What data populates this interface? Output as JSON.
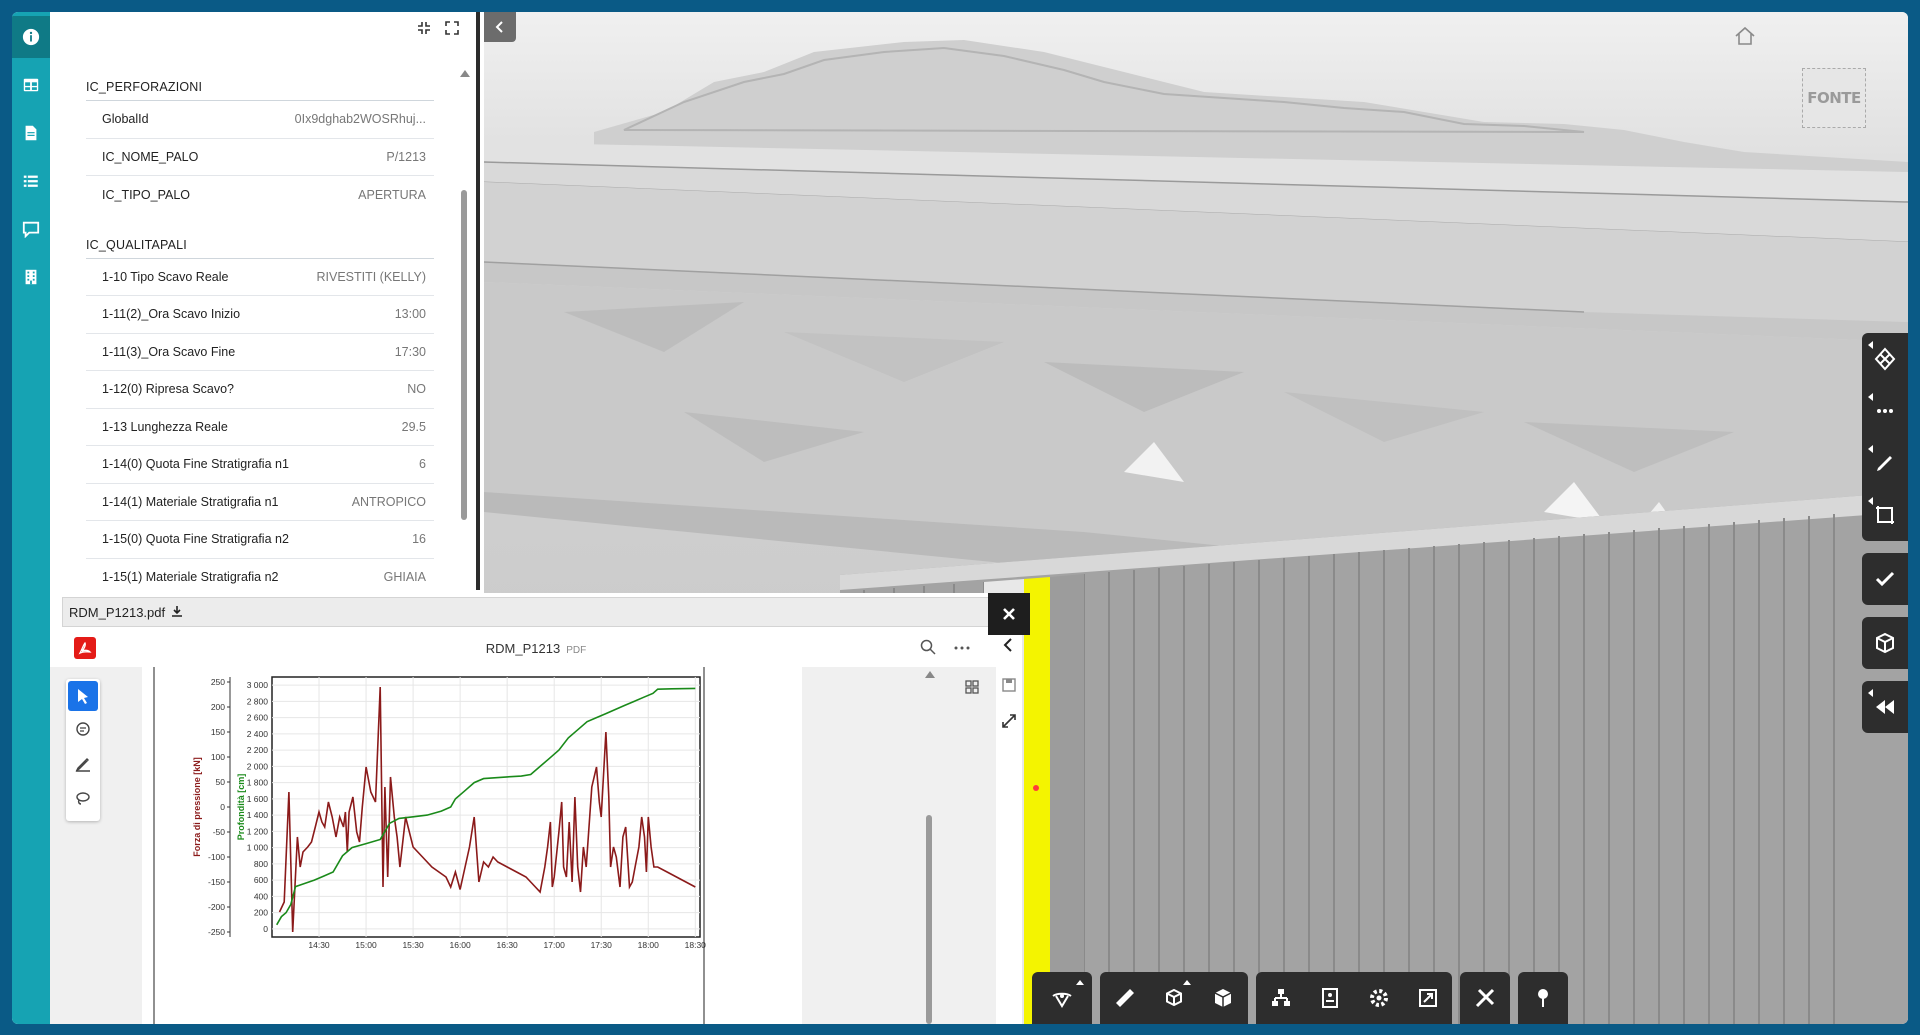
{
  "rail": {
    "items": [
      {
        "name": "info-icon",
        "active": true
      },
      {
        "name": "table-icon"
      },
      {
        "name": "document-icon"
      },
      {
        "name": "list-icon"
      },
      {
        "name": "comment-icon"
      },
      {
        "name": "building-icon"
      }
    ]
  },
  "props": {
    "groups": [
      {
        "title": "IC_PERFORAZIONI",
        "rows": [
          {
            "key": "GlobalId",
            "value": "0Ix9dghab2WOSRhuj..."
          },
          {
            "key": "IC_NOME_PALO",
            "value": "P/1213"
          },
          {
            "key": "IC_TIPO_PALO",
            "value": "APERTURA"
          }
        ]
      },
      {
        "title": "IC_QUALITAPALI",
        "rows": [
          {
            "key": "1-10 Tipo Scavo Reale",
            "value": "RIVESTITI (KELLY)"
          },
          {
            "key": "1-11(2)_Ora Scavo Inizio",
            "value": "13:00"
          },
          {
            "key": "1-11(3)_Ora Scavo Fine",
            "value": "17:30"
          },
          {
            "key": "1-12(0) Ripresa Scavo?",
            "value": "NO"
          },
          {
            "key": "1-13 Lunghezza Reale",
            "value": "29.5"
          },
          {
            "key": "1-14(0) Quota Fine Stratigrafia n1",
            "value": "6"
          },
          {
            "key": "1-14(1) Materiale Stratigrafia n1",
            "value": "ANTROPICO"
          },
          {
            "key": "1-15(0) Quota Fine Stratigrafia n2",
            "value": "16"
          },
          {
            "key": "1-15(1) Materiale Stratigrafia n2",
            "value": "GHIAIA"
          }
        ]
      }
    ]
  },
  "viewer": {
    "cube_label": "FONTE",
    "highlight_color": "#f4f400"
  },
  "pdf": {
    "tab_label": "RDM_P1213.pdf",
    "title": "RDM_P1213",
    "ext": "PDF",
    "logo_color": "#e41b17",
    "active_tool_color": "#1a73e8"
  },
  "chart_data": {
    "type": "line",
    "title": "",
    "ylabel_left": "Forza di pressione [kN]",
    "ylabel_right": "Profondità [cm]",
    "y_left_ticks": [
      250,
      200,
      150,
      100,
      50,
      0,
      -50,
      -100,
      -150,
      -200,
      -250
    ],
    "y_right_ticks": [
      "3 000",
      "2 800",
      "2 600",
      "2 400",
      "2 200",
      "2 000",
      "1 800",
      "1 600",
      "1 400",
      "1 200",
      "1 000",
      "800",
      "600",
      "400",
      "200",
      "0"
    ],
    "x_ticks": [
      "14:30",
      "15:00",
      "15:30",
      "16:00",
      "16:30",
      "17:00",
      "17:30",
      "18:00",
      "18:30"
    ],
    "ylim_left": [
      -260,
      260
    ],
    "ylim_right": [
      -100,
      3100
    ],
    "series": [
      {
        "name": "Forza di pressione [kN]",
        "color": "#8b1a1a",
        "axis": "left",
        "points": [
          [
            14.08,
            -210
          ],
          [
            14.13,
            -190
          ],
          [
            14.18,
            30
          ],
          [
            14.22,
            -250
          ],
          [
            14.27,
            -60
          ],
          [
            14.3,
            -120
          ],
          [
            14.33,
            -90
          ],
          [
            14.38,
            -80
          ],
          [
            14.42,
            -70
          ],
          [
            14.46,
            -40
          ],
          [
            14.5,
            -10
          ],
          [
            14.53,
            -30
          ],
          [
            14.56,
            -40
          ],
          [
            14.6,
            10
          ],
          [
            14.64,
            -20
          ],
          [
            14.68,
            -60
          ],
          [
            14.72,
            -20
          ],
          [
            14.76,
            -40
          ],
          [
            14.78,
            -10
          ],
          [
            14.8,
            -90
          ],
          [
            14.82,
            -10
          ],
          [
            14.86,
            20
          ],
          [
            14.9,
            -50
          ],
          [
            14.93,
            -70
          ],
          [
            14.96,
            0
          ],
          [
            15.0,
            80
          ],
          [
            15.05,
            30
          ],
          [
            15.1,
            10
          ],
          [
            15.15,
            240
          ],
          [
            15.18,
            -160
          ],
          [
            15.2,
            40
          ],
          [
            15.23,
            -140
          ],
          [
            15.26,
            60
          ],
          [
            15.3,
            -20
          ],
          [
            15.33,
            -60
          ],
          [
            15.36,
            -120
          ],
          [
            15.42,
            -20
          ],
          [
            15.5,
            -80
          ],
          [
            15.6,
            -100
          ],
          [
            15.7,
            -120
          ],
          [
            15.85,
            -140
          ],
          [
            15.9,
            -160
          ],
          [
            15.95,
            -130
          ],
          [
            16.0,
            -165
          ],
          [
            16.1,
            -80
          ],
          [
            16.15,
            -20
          ],
          [
            16.2,
            -150
          ],
          [
            16.25,
            -110
          ],
          [
            16.3,
            -120
          ],
          [
            16.35,
            -100
          ],
          [
            16.4,
            -110
          ],
          [
            16.5,
            -120
          ],
          [
            16.6,
            -130
          ],
          [
            16.7,
            -140
          ],
          [
            16.75,
            -150
          ],
          [
            16.8,
            -160
          ],
          [
            16.85,
            -170
          ],
          [
            16.9,
            -120
          ],
          [
            16.93,
            -80
          ],
          [
            16.96,
            -30
          ],
          [
            16.98,
            -160
          ],
          [
            17.0,
            -140
          ],
          [
            17.05,
            -50
          ],
          [
            17.08,
            10
          ],
          [
            17.1,
            -120
          ],
          [
            17.13,
            -140
          ],
          [
            17.16,
            -30
          ],
          [
            17.19,
            -150
          ],
          [
            17.22,
            20
          ],
          [
            17.25,
            -120
          ],
          [
            17.28,
            -170
          ],
          [
            17.31,
            -80
          ],
          [
            17.34,
            -120
          ],
          [
            17.4,
            40
          ],
          [
            17.45,
            80
          ],
          [
            17.48,
            10
          ],
          [
            17.5,
            -20
          ],
          [
            17.55,
            150
          ],
          [
            17.58,
            20
          ],
          [
            17.6,
            -120
          ],
          [
            17.63,
            -80
          ],
          [
            17.66,
            -100
          ],
          [
            17.7,
            -160
          ],
          [
            17.73,
            -60
          ],
          [
            17.76,
            -40
          ],
          [
            17.8,
            -160
          ],
          [
            17.83,
            -150
          ],
          [
            17.86,
            -120
          ],
          [
            17.9,
            -80
          ],
          [
            17.93,
            -20
          ],
          [
            17.96,
            -60
          ],
          [
            17.98,
            -130
          ],
          [
            18.0,
            -20
          ],
          [
            18.03,
            -80
          ],
          [
            18.06,
            -120
          ],
          [
            18.1,
            -120
          ],
          [
            18.2,
            -130
          ],
          [
            18.3,
            -140
          ],
          [
            18.4,
            -150
          ],
          [
            18.5,
            -160
          ]
        ]
      },
      {
        "name": "Profondità [cm]",
        "color": "#1a8a1a",
        "axis": "right",
        "points": [
          [
            14.05,
            50
          ],
          [
            14.1,
            150
          ],
          [
            14.15,
            200
          ],
          [
            14.2,
            300
          ],
          [
            14.25,
            520
          ],
          [
            14.35,
            560
          ],
          [
            14.45,
            600
          ],
          [
            14.55,
            650
          ],
          [
            14.65,
            700
          ],
          [
            14.75,
            900
          ],
          [
            14.85,
            1000
          ],
          [
            15.0,
            1050
          ],
          [
            15.15,
            1100
          ],
          [
            15.25,
            1300
          ],
          [
            15.35,
            1360
          ],
          [
            15.5,
            1380
          ],
          [
            15.65,
            1400
          ],
          [
            15.8,
            1450
          ],
          [
            15.9,
            1500
          ],
          [
            15.95,
            1600
          ],
          [
            16.05,
            1700
          ],
          [
            16.15,
            1800
          ],
          [
            16.25,
            1850
          ],
          [
            16.5,
            1870
          ],
          [
            16.65,
            1880
          ],
          [
            16.75,
            1900
          ],
          [
            16.85,
            2000
          ],
          [
            16.95,
            2100
          ],
          [
            17.05,
            2200
          ],
          [
            17.15,
            2350
          ],
          [
            17.25,
            2450
          ],
          [
            17.35,
            2550
          ],
          [
            17.45,
            2600
          ],
          [
            17.55,
            2650
          ],
          [
            17.65,
            2700
          ],
          [
            17.75,
            2750
          ],
          [
            17.85,
            2800
          ],
          [
            17.95,
            2850
          ],
          [
            18.05,
            2900
          ],
          [
            18.1,
            2950
          ],
          [
            18.25,
            2955
          ],
          [
            18.5,
            2960
          ]
        ]
      }
    ]
  }
}
